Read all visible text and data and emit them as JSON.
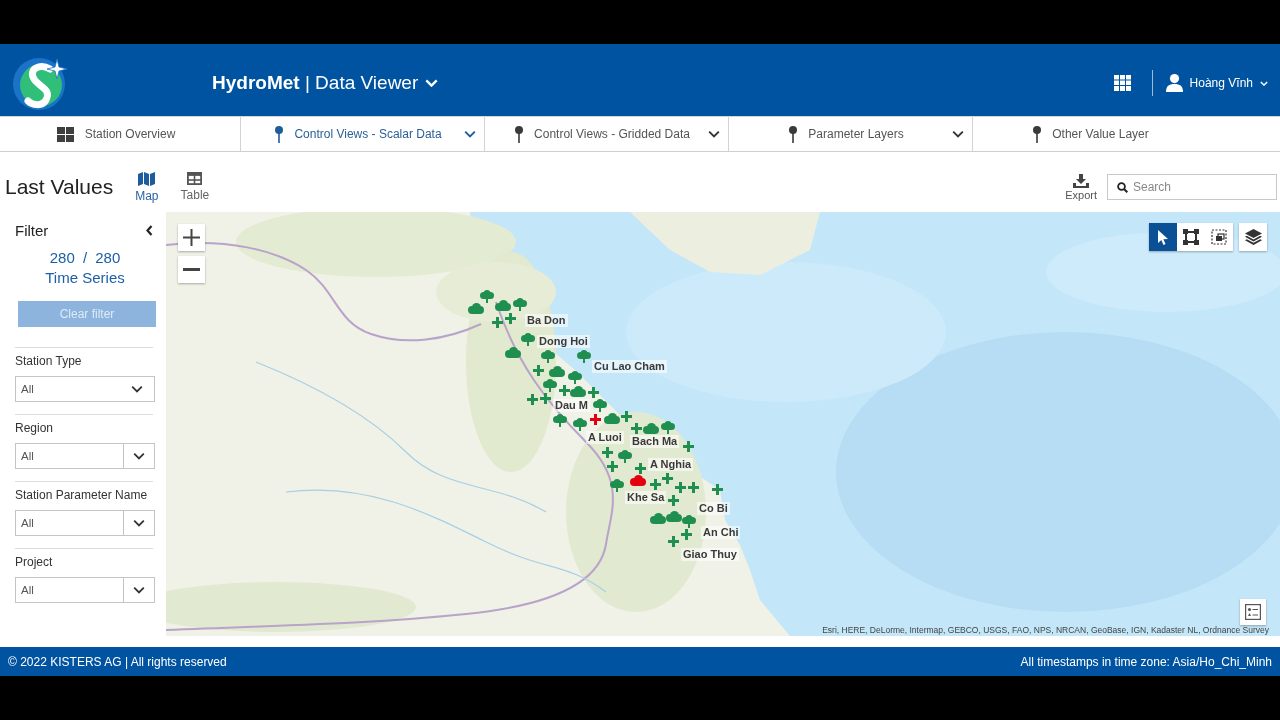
{
  "header": {
    "title": "**HydroMet** | Data Viewer",
    "user": "Hoàng Vĩnh"
  },
  "nav_tabs": [
    {
      "label": "Station Overview",
      "kind": "grid",
      "selected": false,
      "dropdown": false
    },
    {
      "label": "Control Views - Scalar Data",
      "kind": "pin",
      "selected": true,
      "dropdown": true
    },
    {
      "label": "Control Views - Gridded Data",
      "kind": "pin",
      "selected": false,
      "dropdown": true
    },
    {
      "label": "Parameter Layers",
      "kind": "pin",
      "selected": false,
      "dropdown": true
    },
    {
      "label": "Other Value Layer",
      "kind": "pin",
      "selected": false,
      "dropdown": false
    }
  ],
  "toolbar": {
    "title": "Last Values",
    "views": [
      {
        "label": "Map",
        "kind": "map",
        "selected": true
      },
      {
        "label": "Table",
        "kind": "table",
        "selected": false
      }
    ],
    "export": "Export",
    "search": {
      "placeholder": "Search"
    }
  },
  "filter": {
    "title": "Filter",
    "count": "280 / 280",
    "unit": "Time Series",
    "clear_button": {
      "label": "Clear filter",
      "disabled": true
    },
    "fields": [
      {
        "label": "Station Type",
        "value": "All",
        "kind": "plain"
      },
      {
        "label": "Region",
        "value": "All",
        "kind": "split"
      },
      {
        "label": "Station Parameter Name",
        "value": "All",
        "kind": "split"
      },
      {
        "label": "Project",
        "value": "All",
        "kind": "split"
      }
    ]
  },
  "map": {
    "tools": [
      {
        "kind": "pointer",
        "selected": true
      },
      {
        "kind": "box",
        "selected": false
      },
      {
        "kind": "frame",
        "selected": false
      }
    ],
    "station_labels": [
      "Ba Don",
      "Dong Hoi",
      "Cu Lao Cham",
      "Dau M",
      "A Luoi",
      "Bach Ma",
      "A Nghia",
      "Khe Sa",
      "Co Bi",
      "An Chi",
      "Giao Thuy"
    ],
    "markers": [
      {
        "kind": "tree",
        "color": "#1f8f4f"
      },
      {
        "kind": "cloud",
        "color": "#1f8f4f"
      },
      {
        "kind": "cloud",
        "color": "#1f8f4f"
      },
      {
        "kind": "tree",
        "color": "#1f8f4f"
      },
      {
        "kind": "plus",
        "color": "#1f8f4f"
      },
      {
        "kind": "plus",
        "color": "#1f8f4f"
      },
      {
        "kind": "tree",
        "color": "#1f8f4f"
      },
      {
        "kind": "cloud",
        "color": "#1f8f4f"
      },
      {
        "kind": "tree",
        "color": "#1f8f4f"
      },
      {
        "kind": "plus",
        "color": "#1f8f4f"
      },
      {
        "kind": "tree",
        "color": "#1f8f4f"
      },
      {
        "kind": "cloud",
        "color": "#1f8f4f"
      },
      {
        "kind": "tree",
        "color": "#1f8f4f"
      },
      {
        "kind": "plus",
        "color": "#1f8f4f"
      },
      {
        "kind": "tree",
        "color": "#1f8f4f"
      },
      {
        "kind": "plus",
        "color": "#1f8f4f"
      },
      {
        "kind": "plus",
        "color": "#1f8f4f"
      },
      {
        "kind": "cloud",
        "color": "#1f8f4f"
      },
      {
        "kind": "plus",
        "color": "#1f8f4f"
      },
      {
        "kind": "tree",
        "color": "#1f8f4f"
      },
      {
        "kind": "cloud",
        "color": "#1f8f4f"
      },
      {
        "kind": "plus",
        "color": "#e3000f"
      },
      {
        "kind": "tree",
        "color": "#1f8f4f"
      },
      {
        "kind": "tree",
        "color": "#1f8f4f"
      },
      {
        "kind": "plus",
        "color": "#1f8f4f"
      },
      {
        "kind": "plus",
        "color": "#1f8f4f"
      },
      {
        "kind": "cloud",
        "color": "#1f8f4f"
      },
      {
        "kind": "tree",
        "color": "#1f8f4f"
      },
      {
        "kind": "plus",
        "color": "#1f8f4f"
      },
      {
        "kind": "tree",
        "color": "#1f8f4f"
      },
      {
        "kind": "plus",
        "color": "#1f8f4f"
      },
      {
        "kind": "plus",
        "color": "#1f8f4f"
      },
      {
        "kind": "cloud",
        "color": "#e3000f"
      },
      {
        "kind": "plus",
        "color": "#1f8f4f"
      },
      {
        "kind": "plus",
        "color": "#1f8f4f"
      },
      {
        "kind": "plus",
        "color": "#1f8f4f"
      },
      {
        "kind": "tree",
        "color": "#1f8f4f"
      },
      {
        "kind": "plus",
        "color": "#1f8f4f"
      },
      {
        "kind": "plus",
        "color": "#1f8f4f"
      },
      {
        "kind": "plus",
        "color": "#1f8f4f"
      },
      {
        "kind": "plus",
        "color": "#1f8f4f"
      },
      {
        "kind": "cloud",
        "color": "#1f8f4f"
      },
      {
        "kind": "cloud",
        "color": "#1f8f4f"
      },
      {
        "kind": "tree",
        "color": "#1f8f4f"
      },
      {
        "kind": "plus",
        "color": "#1f8f4f"
      },
      {
        "kind": "plus",
        "color": "#1f8f4f"
      }
    ],
    "attribution": "Esri, HERE, DeLorme, Intermap, GEBCO, USGS, FAO, NPS, NRCAN, GeoBase, IGN, Kadaster NL, Ordnance Survey"
  },
  "footer": {
    "copyright": "© 2022 KISTERS AG | All rights reserved",
    "timezone": "All timestamps in time zone: Asia/Ho_Chi_Minh"
  }
}
